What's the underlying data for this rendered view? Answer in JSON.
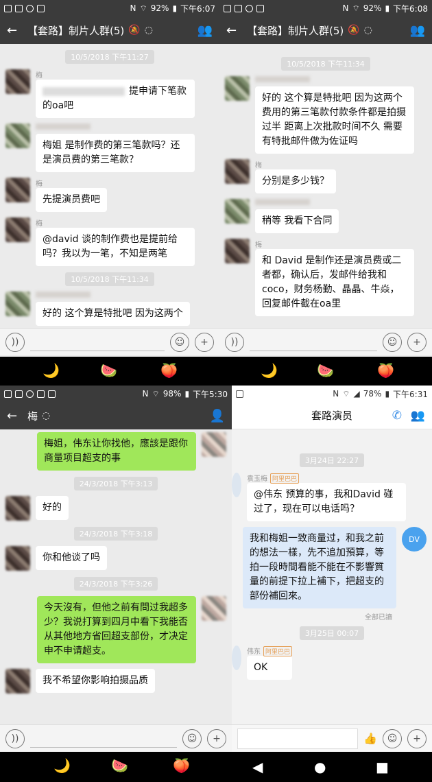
{
  "panel1": {
    "status": {
      "battery": "92%",
      "time": "下午6:07"
    },
    "title": "【套路】制片人群(5)",
    "messages": [
      {
        "kind": "time",
        "text": "10/5/2018 下午11:27"
      },
      {
        "kind": "msg",
        "sender": "梅",
        "text": "提申请下笔款的oa吧",
        "blurred_prefix": true
      },
      {
        "kind": "msg",
        "sender": "",
        "text": "梅姐 是制作费的第三笔款吗？还是演员费的第三笔款？",
        "avatar": "green"
      },
      {
        "kind": "msg",
        "sender": "梅",
        "text": "先提演员费吧"
      },
      {
        "kind": "msg",
        "sender": "梅",
        "text": "@david  谈的制作费也是提前给吗？我以为一笔，不知是两笔"
      },
      {
        "kind": "time",
        "text": "10/5/2018 下午11:34"
      },
      {
        "kind": "msg",
        "sender": "",
        "text": "好的 这个算是特批吧 因为这两个",
        "avatar": "green"
      }
    ]
  },
  "panel2": {
    "status": {
      "battery": "92%",
      "time": "下午6:08"
    },
    "title": "【套路】制片人群(5)",
    "messages": [
      {
        "kind": "time",
        "text": "10/5/2018 下午11:34"
      },
      {
        "kind": "msg",
        "sender": "",
        "text": "好的 这个算是特批吧 因为这两个费用的第三笔款付款条件都是拍摄过半 距离上次批款时间不久 需要有特批邮件做为佐证吗",
        "avatar": "green"
      },
      {
        "kind": "msg",
        "sender": "梅",
        "text": "分别是多少钱？"
      },
      {
        "kind": "msg",
        "sender": "",
        "text": "稍等 我看下合同",
        "avatar": "green"
      },
      {
        "kind": "msg",
        "sender": "梅",
        "text": "和 David 是制作还是演员费或二者都，确认后，发邮件给我和coco，财务杨勤、晶晶、牛焱，回复邮件截在oa里"
      }
    ]
  },
  "panel3": {
    "status": {
      "battery": "98%",
      "time": "下午5:30"
    },
    "title": "梅",
    "messages": [
      {
        "kind": "msg",
        "side": "right",
        "text": "梅姐，伟东让你找他，應該是跟你商量项目超支的事",
        "avatar": "pink"
      },
      {
        "kind": "time",
        "text": "24/3/2018 下午3:13"
      },
      {
        "kind": "msg",
        "side": "left",
        "text": "好的"
      },
      {
        "kind": "time",
        "text": "24/3/2018 下午3:18"
      },
      {
        "kind": "msg",
        "side": "left",
        "text": "你和他谈了吗"
      },
      {
        "kind": "time",
        "text": "24/3/2018 下午3:26"
      },
      {
        "kind": "msg",
        "side": "right",
        "text": "今天沒有，但他之前有問过我超多少？我说打算到四月中看下我能否从其他地方省回超支部份，才决定申不申请超支。",
        "avatar": "pink"
      },
      {
        "kind": "msg",
        "side": "left",
        "text": "我不希望你影响拍摄品质"
      }
    ]
  },
  "panel4": {
    "status": {
      "battery": "78%",
      "time": "下午6:31"
    },
    "title": "套路演员",
    "messages": [
      {
        "kind": "time",
        "text": "3月24日 22:27"
      },
      {
        "kind": "msg",
        "side": "left",
        "sender": "袁玉梅",
        "tag": "阿里巴巴",
        "text": "@伟东 预算的事，我和David 碰过了，现在可以电话吗？"
      },
      {
        "kind": "msg",
        "side": "right",
        "avatar_text": "DV",
        "text": "我和梅姐一致商量过，和我之前的想法一樣，先不追加預算，等拍一段時間看能不能在不影響質量的前提下拉上補下，把超支的部份補回來。",
        "read": "全部已讀"
      },
      {
        "kind": "time",
        "text": "3月25日 00:07"
      },
      {
        "kind": "msg",
        "side": "left",
        "sender": "伟东",
        "tag": "阿里巴巴",
        "text": "OK"
      }
    ]
  },
  "icons": {
    "emoji_1": "🌙",
    "emoji_2": "🍉",
    "emoji_3": "🍑",
    "nav_back": "◀",
    "nav_home": "●",
    "nav_recent": "■"
  },
  "colors": {
    "wechat_bar": "#3b3b3b",
    "green_bubble": "#a0e75a",
    "dingtalk_blue": "#3a8ee6"
  }
}
